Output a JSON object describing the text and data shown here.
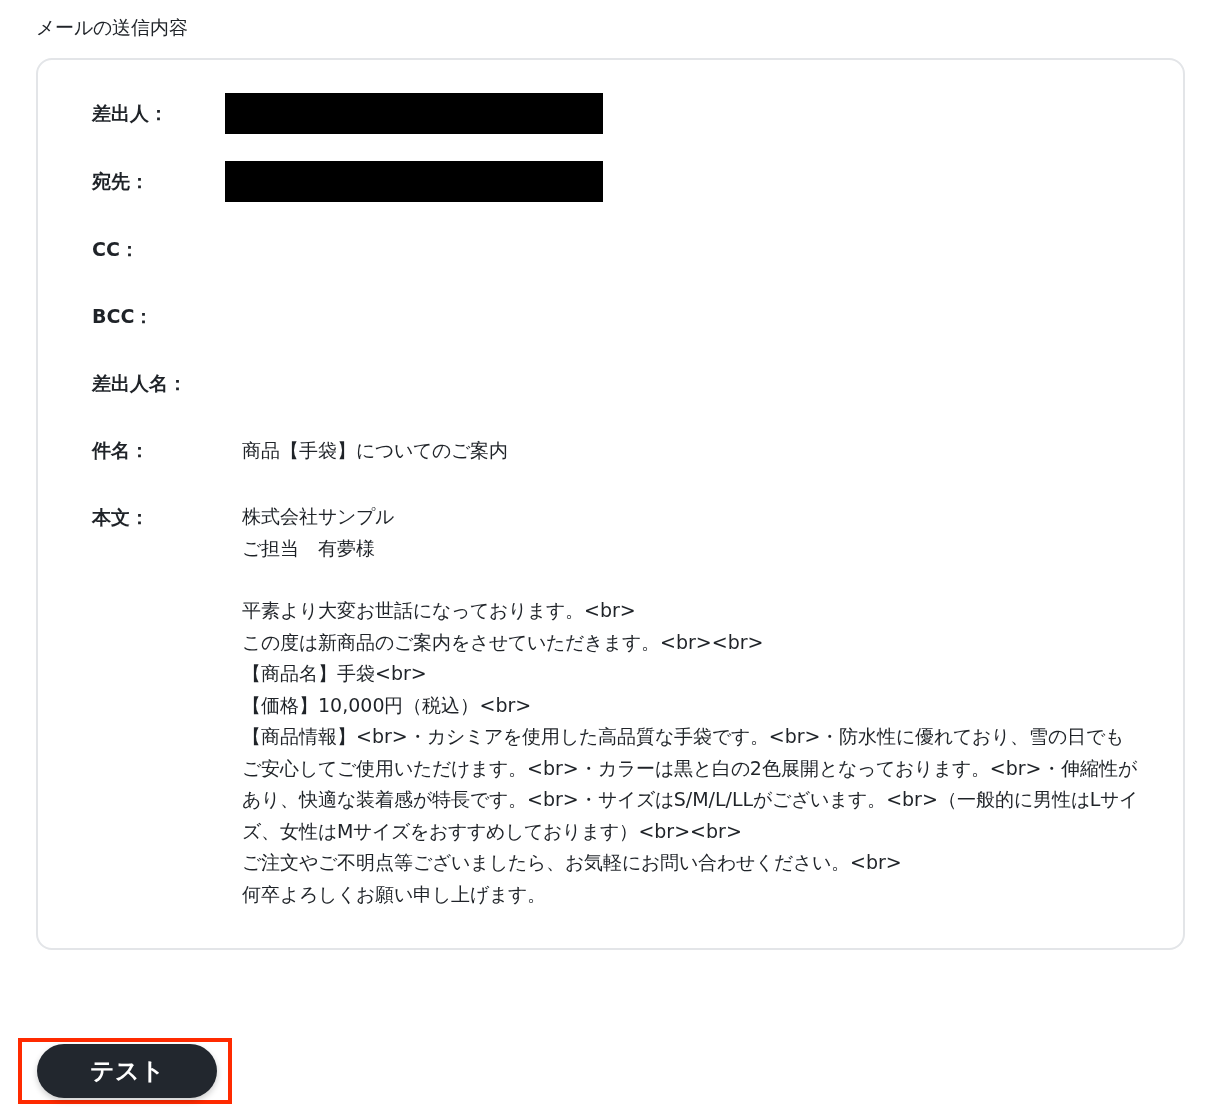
{
  "section_title": "メールの送信内容",
  "fields": [
    {
      "label": "差出人：",
      "kind": "redacted"
    },
    {
      "label": "宛先：",
      "kind": "redacted"
    },
    {
      "label": "CC：",
      "kind": "empty"
    },
    {
      "label": "BCC：",
      "kind": "empty"
    },
    {
      "label": "差出人名：",
      "kind": "empty"
    },
    {
      "label": "件名：",
      "kind": "text",
      "value": "商品【手袋】についてのご案内"
    },
    {
      "label": "本文：",
      "kind": "body",
      "paragraphs": [
        [
          "株式会社サンプル",
          "ご担当　有夢様"
        ],
        [
          "平素より大変お世話になっております。<br>",
          "この度は新商品のご案内をさせていただきます。<br><br>",
          "【商品名】手袋<br>",
          "【価格】10,000円（税込）<br>",
          "【商品情報】<br>・カシミアを使用した高品質な手袋です。<br>・防水性に優れており、雪の日でもご安心してご使用いただけます。<br>・カラーは黒と白の2色展開となっております。<br>・伸縮性があり、快適な装着感が特長です。<br>・サイズはS/M/L/LLがございます。<br>（一般的に男性はLサイズ、女性はMサイズをおすすめしております）<br><br>",
          "ご注文やご不明点等ございましたら、お気軽にお問い合わせください。<br>",
          "何卒よろしくお願い申し上げます。"
        ]
      ]
    }
  ],
  "test_button": {
    "label": "テスト",
    "highlighted": true
  }
}
